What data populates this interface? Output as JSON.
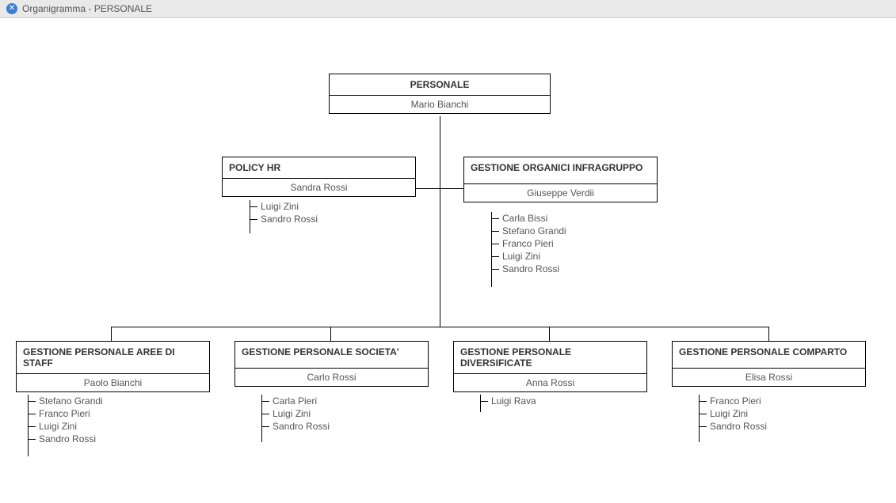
{
  "window": {
    "title": "Organigramma - PERSONALE"
  },
  "org": {
    "root": {
      "title": "PERSONALE",
      "owner": "Mario Bianchi"
    },
    "mid_left": {
      "title": "POLICY HR",
      "owner": "Sandra Rossi",
      "staff": [
        "Luigi Zini",
        "Sandro Rossi"
      ]
    },
    "mid_right": {
      "title": "GESTIONE ORGANICI INFRAGRUPPO",
      "owner": "Giuseppe Verdii",
      "staff": [
        "Carla Bissi",
        "Stefano Grandi",
        "Franco Pieri",
        "Luigi Zini",
        "Sandro Rossi"
      ]
    },
    "bottom": [
      {
        "title": "GESTIONE PERSONALE AREE DI STAFF",
        "owner": "Paolo Bianchi",
        "staff": [
          "Stefano Grandi",
          "Franco Pieri",
          "Luigi Zini",
          "Sandro Rossi"
        ]
      },
      {
        "title": "GESTIONE PERSONALE SOCIETA'",
        "owner": "Carlo Rossi",
        "staff": [
          "Carla Pieri",
          "Luigi Zini",
          "Sandro Rossi"
        ]
      },
      {
        "title": "GESTIONE PERSONALE DIVERSIFICATE",
        "owner": "Anna Rossi",
        "staff": [
          "Luigi Rava"
        ]
      },
      {
        "title": "GESTIONE PERSONALE COMPARTO",
        "owner": "Elisa Rossi",
        "staff": [
          "Franco Pieri",
          "Luigi Zini",
          "Sandro Rossi"
        ]
      }
    ]
  }
}
